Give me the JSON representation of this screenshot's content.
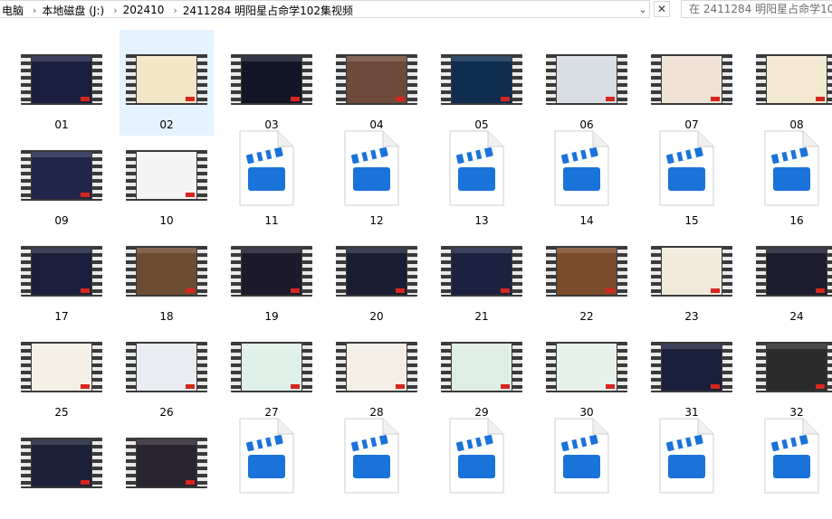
{
  "address_bar": {
    "crumbs": [
      "电脑",
      "本地磁盘 (J:)",
      "202410",
      "2411284 明阳星占命学102集视频"
    ],
    "search_placeholder": "在 2411284 明阳星占命学10..."
  },
  "colors": {
    "selection": "#e5f3ff",
    "file_icon_blue": "#1a73d9"
  },
  "files": [
    {
      "name": "01",
      "kind": "video-thumb",
      "theme": "#1a1f3e"
    },
    {
      "name": "02",
      "kind": "video-thumb",
      "theme": "#f3e6c6",
      "selected": true
    },
    {
      "name": "03",
      "kind": "video-thumb",
      "theme": "#121626"
    },
    {
      "name": "04",
      "kind": "video-thumb",
      "theme": "#6d4a3a"
    },
    {
      "name": "05",
      "kind": "video-thumb",
      "theme": "#0f2d4f"
    },
    {
      "name": "06",
      "kind": "video-thumb",
      "theme": "#d9dde4"
    },
    {
      "name": "07",
      "kind": "video-thumb",
      "theme": "#efe2d5"
    },
    {
      "name": "08",
      "kind": "video-thumb",
      "theme": "#f2e7cf"
    },
    {
      "name": "09",
      "kind": "video-thumb",
      "theme": "#22264a"
    },
    {
      "name": "10",
      "kind": "video-thumb",
      "theme": "#f4f4f4"
    },
    {
      "name": "11",
      "kind": "video-file"
    },
    {
      "name": "12",
      "kind": "video-file"
    },
    {
      "name": "13",
      "kind": "video-file"
    },
    {
      "name": "14",
      "kind": "video-file"
    },
    {
      "name": "15",
      "kind": "video-file"
    },
    {
      "name": "16",
      "kind": "video-file"
    },
    {
      "name": "17",
      "kind": "video-thumb",
      "theme": "#1b1f3b"
    },
    {
      "name": "18",
      "kind": "video-thumb",
      "theme": "#6b4b32"
    },
    {
      "name": "19",
      "kind": "video-thumb",
      "theme": "#1d1a2c"
    },
    {
      "name": "20",
      "kind": "video-thumb",
      "theme": "#1a1d33"
    },
    {
      "name": "21",
      "kind": "video-thumb",
      "theme": "#1c2140"
    },
    {
      "name": "22",
      "kind": "video-thumb",
      "theme": "#7a4c2b"
    },
    {
      "name": "23",
      "kind": "video-thumb",
      "theme": "#f1eadb"
    },
    {
      "name": "24",
      "kind": "video-thumb",
      "theme": "#1c1c2e"
    },
    {
      "name": "25",
      "kind": "video-thumb",
      "theme": "#f4f0e6"
    },
    {
      "name": "26",
      "kind": "video-thumb",
      "theme": "#e9ecf0"
    },
    {
      "name": "27",
      "kind": "video-thumb",
      "theme": "#dff0e8"
    },
    {
      "name": "28",
      "kind": "video-thumb",
      "theme": "#f3efe7"
    },
    {
      "name": "29",
      "kind": "video-thumb",
      "theme": "#dfeee4"
    },
    {
      "name": "30",
      "kind": "video-thumb",
      "theme": "#e6f1ea"
    },
    {
      "name": "31",
      "kind": "video-thumb",
      "theme": "#1a1f3b"
    },
    {
      "name": "32",
      "kind": "video-thumb",
      "theme": "#2b2b2b"
    },
    {
      "name": "",
      "kind": "video-thumb",
      "theme": "#1c2038"
    },
    {
      "name": "",
      "kind": "video-thumb",
      "theme": "#2a2330"
    },
    {
      "name": "",
      "kind": "video-file"
    },
    {
      "name": "",
      "kind": "video-file"
    },
    {
      "name": "",
      "kind": "video-file"
    },
    {
      "name": "",
      "kind": "video-file"
    },
    {
      "name": "",
      "kind": "video-file"
    },
    {
      "name": "",
      "kind": "video-file"
    }
  ]
}
